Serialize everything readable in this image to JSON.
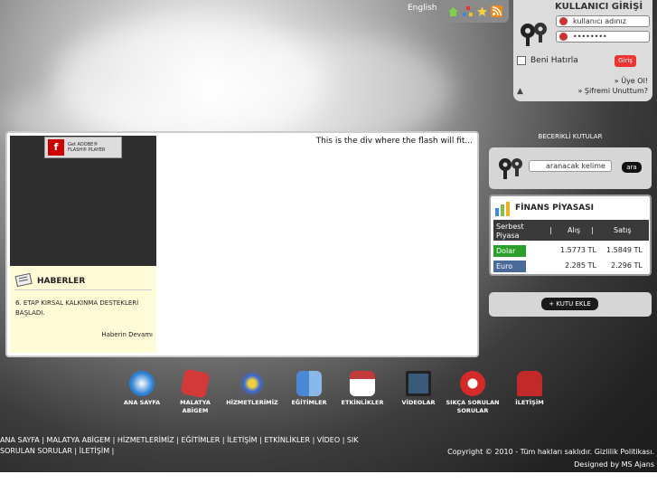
{
  "topbar": {
    "language": "English"
  },
  "login": {
    "title": "KULLANICI GİRİŞİ",
    "username_placeholder": "kullanıcı adınız",
    "password_value": "••••••••",
    "remember_label": "Beni Hatırla",
    "submit_label": "Giriş",
    "register_label": "» Üye Ol!",
    "forgot_label": "» Şifremi Unuttum?"
  },
  "flash": {
    "badge_line1": "Get ADOBE®",
    "badge_line2": "FLASH® PLAYER",
    "note": "This is the div where the flash will fit..."
  },
  "news": {
    "title": "HABERLER",
    "headline": "6. ETAP KIRSAL KALKINMA DESTEKLERİ BAŞLADI.",
    "more": "Haberin Devamı"
  },
  "sidebar": {
    "section_title": "BECERİKLİ KUTULAR",
    "search_placeholder": "aranacak kelime",
    "search_button": "ara",
    "add_box_label": "+ KUTU EKLE"
  },
  "finance": {
    "title": "FİNANS PİYASASI",
    "col_market": "Serbest Piyasa",
    "col_buy": "Alış",
    "col_sell": "Satış",
    "rows": [
      {
        "name": "Dolar",
        "buy": "1.5773 TL",
        "sell": "1.5849 TL",
        "color": "#2aa02a"
      },
      {
        "name": "Euro",
        "buy": "2.285 TL",
        "sell": "2.296 TL",
        "color": "#4a6a9a"
      }
    ]
  },
  "nav": [
    {
      "label": "ANA SAYFA",
      "icon": "compass-icon",
      "color": "#2a7fd4"
    },
    {
      "label": "MALATYA ABİGEM",
      "icon": "cube-icon",
      "color": "#d23a3a"
    },
    {
      "label": "HİZMETLERİMİZ",
      "icon": "network-icon",
      "color": "#3a6ad4"
    },
    {
      "label": "EĞİTİMLER",
      "icon": "finder-icon",
      "color": "#4a8ad4"
    },
    {
      "label": "ETKİNLİKLER",
      "icon": "calendar-icon",
      "color": "#c23a3a"
    },
    {
      "label": "VİDEOLAR",
      "icon": "monitor-icon",
      "color": "#3a5a7a"
    },
    {
      "label": "SIKÇA SORULAN SORULAR",
      "icon": "help-icon",
      "color": "#d42a2a"
    },
    {
      "label": "İLETİŞİM",
      "icon": "mailbox-icon",
      "color": "#c22a2a"
    }
  ],
  "footer": {
    "links_line1": "ANA SAYFA | MALATYA ABİGEM | HİZMETLERİMİZ | EĞİTİMLER | İLETİŞİM | ETKİNLİKLER | VİDEO | SIK",
    "links_line2": "SORULAN SORULAR | İLETİŞİM |",
    "copyright": "Copyright © 2010 - Tüm hakları saklıdır. Gizlilik Politikası.",
    "designer": "Designed by MS Ajans"
  }
}
